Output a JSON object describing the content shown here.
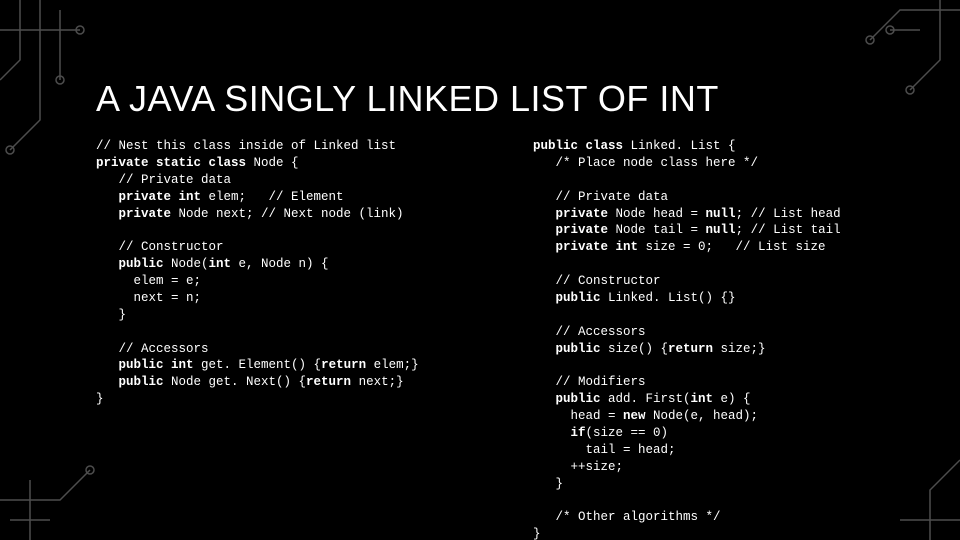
{
  "title": "A JAVA SINGLY LINKED LIST OF INT",
  "left": {
    "l1": "// Nest this class inside of Linked list",
    "l2a": "private static class",
    "l2b": " Node {",
    "l3": "   // Private data",
    "l4a": "   private int",
    "l4b": " elem;   // Element",
    "l5a": "   private",
    "l5b": " Node next; // Next node (link)",
    "l6": "",
    "l7": "   // Constructor",
    "l8a": "   public",
    "l8b": " Node(",
    "l8c": "int",
    "l8d": " e, Node n) {",
    "l9": "     elem = e;",
    "l10": "     next = n;",
    "l11": "   }",
    "l12": "",
    "l13": "   // Accessors",
    "l14a": "   public int",
    "l14b": " get. Element() {",
    "l14c": "return",
    "l14d": " elem;}",
    "l15a": "   public",
    "l15b": " Node get. Next() {",
    "l15c": "return",
    "l15d": " next;}",
    "l16": "}"
  },
  "right": {
    "l1a": "public class",
    "l1b": " Linked. List {",
    "l2": "   /* Place node class here */",
    "l3": "",
    "l4": "   // Private data",
    "l5a": "   private",
    "l5b": " Node head = ",
    "l5c": "null",
    "l5d": "; // List head",
    "l6a": "   private",
    "l6b": " Node tail = ",
    "l6c": "null",
    "l6d": "; // List tail",
    "l7a": "   private int",
    "l7b": " size = 0;   // List size",
    "l8": "",
    "l9": "   // Constructor",
    "l10a": "   public",
    "l10b": " Linked. List() {}",
    "l11": "",
    "l12": "   // Accessors",
    "l13a": "   public",
    "l13b": " size() {",
    "l13c": "return",
    "l13d": " size;}",
    "l14": "",
    "l15": "   // Modifiers",
    "l16a": "   public",
    "l16b": " add. First(",
    "l16c": "int",
    "l16d": " e) {",
    "l17a": "     head = ",
    "l17b": "new",
    "l17c": " Node(e, head);",
    "l18a": "     if",
    "l18b": "(size == 0)",
    "l19": "       tail = head;",
    "l20": "     ++size;",
    "l21": "   }",
    "l22": "",
    "l23": "   /* Other algorithms */",
    "l24": "}"
  }
}
